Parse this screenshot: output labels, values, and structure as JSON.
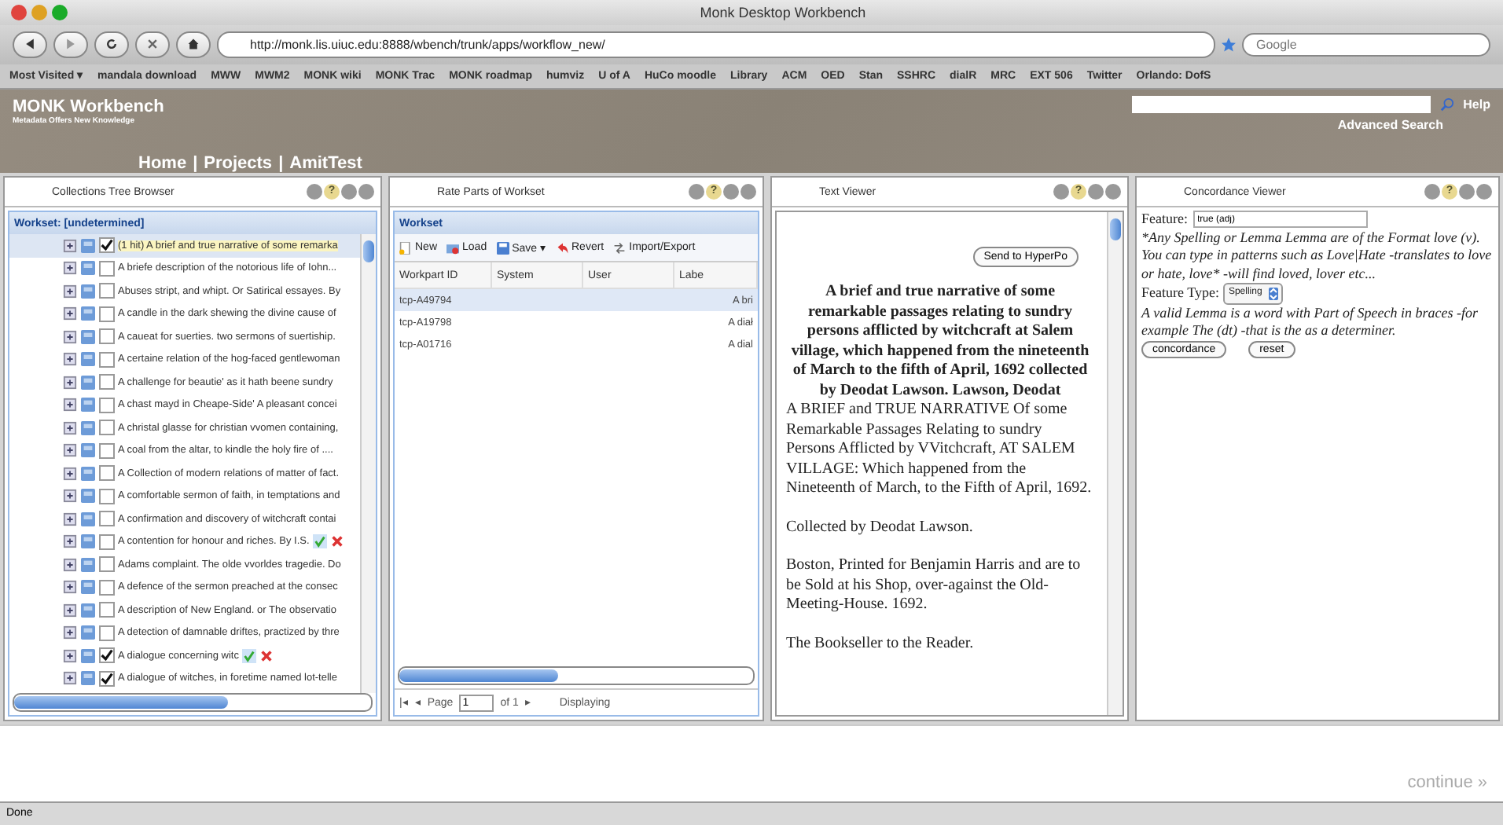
{
  "window": {
    "title": "Monk Desktop Workbench"
  },
  "browser": {
    "url": "http://monk.lis.uiuc.edu:8888/wbench/trunk/apps/workflow_new/",
    "search_placeholder": "Google",
    "bookmarks": [
      "Most Visited ▾",
      "mandala download",
      "MWW",
      "MWM2",
      "MONK wiki",
      "MONK Trac",
      "MONK roadmap",
      "humviz",
      "U of A",
      "HuCo moodle",
      "Library",
      "ACM",
      "OED",
      "Stan",
      "SSHRC",
      "dialR",
      "MRC",
      "EXT 506",
      "Twitter",
      "Orlando: DofS"
    ]
  },
  "header": {
    "brand": "MONK Workbench",
    "tagline": "Metadata Offers New Knowledge",
    "nav": [
      "Home",
      "Projects",
      "AmitTest"
    ],
    "separator": "|",
    "help": "Help",
    "advanced_search": "Advanced Search"
  },
  "panels": [
    {
      "title": "Collections Tree Browser",
      "help": "?"
    },
    {
      "title": "Rate Parts of Workset",
      "help": "?"
    },
    {
      "title": "Text Viewer",
      "help": "?"
    },
    {
      "title": "Concordance Viewer",
      "help": "?"
    }
  ],
  "tree": {
    "heading": "Workset: [undetermined]",
    "items": [
      {
        "label": "(1 hit) A brief and true narrative of some remarka",
        "checked": true,
        "selected": true,
        "rated": false
      },
      {
        "label": "A briefe description of the notorious life of Iohn...",
        "checked": false,
        "selected": false,
        "rated": false
      },
      {
        "label": "Abuses stript, and whipt. Or Satirical essayes. By",
        "checked": false,
        "selected": false,
        "rated": false
      },
      {
        "label": "A candle in the dark shewing the divine cause of",
        "checked": false,
        "selected": false,
        "rated": false
      },
      {
        "label": "A caueat for suerties. two sermons of suertiship.",
        "checked": false,
        "selected": false,
        "rated": false
      },
      {
        "label": "A certaine relation of the hog-faced gentlewoman",
        "checked": false,
        "selected": false,
        "rated": false
      },
      {
        "label": "A challenge for beautie' as it hath beene sundry",
        "checked": false,
        "selected": false,
        "rated": false
      },
      {
        "label": "A chast mayd in Cheape-Side' A pleasant concei",
        "checked": false,
        "selected": false,
        "rated": false
      },
      {
        "label": "A christal glasse for christian vvomen containing,",
        "checked": false,
        "selected": false,
        "rated": false
      },
      {
        "label": "A coal from the altar, to kindle the holy fire of ....",
        "checked": false,
        "selected": false,
        "rated": false
      },
      {
        "label": "A Collection of modern relations of matter of fact.",
        "checked": false,
        "selected": false,
        "rated": false
      },
      {
        "label": "A comfortable sermon of faith, in temptations and",
        "checked": false,
        "selected": false,
        "rated": false
      },
      {
        "label": "A confirmation and discovery of witchcraft contai",
        "checked": false,
        "selected": false,
        "rated": false
      },
      {
        "label": "A contention for honour and riches. By I.S.",
        "checked": false,
        "selected": false,
        "rated": true
      },
      {
        "label": "Adams complaint. The olde vvorldes tragedie. Do",
        "checked": false,
        "selected": false,
        "rated": false
      },
      {
        "label": "A defence of the sermon preached at the consec",
        "checked": false,
        "selected": false,
        "rated": false
      },
      {
        "label": "A description of New England. or The observatio",
        "checked": false,
        "selected": false,
        "rated": false
      },
      {
        "label": "A detection of damnable driftes, practized by thre",
        "checked": false,
        "selected": false,
        "rated": false
      },
      {
        "label": "A dialogue concerning witc",
        "checked": true,
        "selected": false,
        "rated": true
      },
      {
        "label": "A dialogue of witches, in foretime named lot-telle",
        "checked": true,
        "selected": false,
        "rated": false
      }
    ]
  },
  "workset": {
    "heading": "Workset",
    "toolbar": [
      "New",
      "Load",
      "Save ▾",
      "Revert",
      "Import/Export"
    ],
    "columns": [
      "Workpart ID",
      "System",
      "User",
      "Labe"
    ],
    "rows": [
      {
        "id": "tcp-A49794",
        "label": "A bri",
        "selected": true
      },
      {
        "id": "tcp-A19798",
        "label": "A diał",
        "selected": false
      },
      {
        "id": "tcp-A01716",
        "label": "A dial",
        "selected": false
      }
    ],
    "paging": {
      "first": "|◂",
      "prev": "◂",
      "next": "▸",
      "page_label": "Page",
      "page": "1",
      "of": "of 1",
      "display": "Displaying"
    }
  },
  "text_viewer": {
    "button": "Send to HyperPo",
    "title": "A brief and true narrative of some remarkable passages relating to sundry persons afflicted by witchcraft at Salem village, which happened from the nineteenth of March to the fifth of April, 1692 collected by Deodat Lawson. Lawson, Deodat",
    "paragraphs": [
      "A BRIEF and TRUE NARRATIVE Of some Remarkable Passages Relating to sundry Persons Afflicted by VVitchcraft, AT SALEM VILLAGE: Which happened from the Nineteenth of March, to the Fifth of April, 1692.",
      "Collected by Deodat Lawson.",
      "Boston, Printed for Benjamin Harris and are to be Sold at his Shop, over-against the Old-Meeting-House. 1692.",
      "The Bookseller to the Reader."
    ]
  },
  "concordance": {
    "feature_label": "Feature:",
    "feature_value": "true (adj)",
    "hint": "*Any Spelling or Lemma Lemma are of the Format love (v). You can type in patterns such as Love|Hate -translates to love or hate, love* -will find loved, lover etc...",
    "type_label": "Feature Type:",
    "type_value": "Spelling",
    "lemma_hint": "A valid Lemma is a word with Part of Speech in braces -for example The (dt) -that is the as a determiner.",
    "buttons": [
      "concordance",
      "reset"
    ]
  },
  "footer": {
    "continue": "continue »"
  },
  "status_bar": "Done"
}
